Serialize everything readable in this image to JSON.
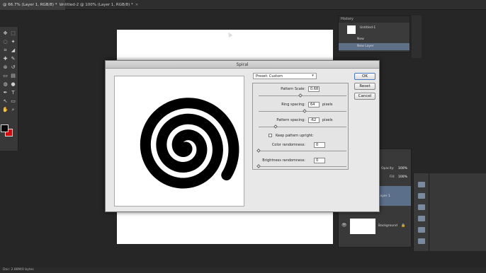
{
  "tabs": [
    {
      "label": "@ 66.7% (Layer 1, RGB/8) *",
      "close": "×"
    },
    {
      "label": "Untitled-2 @ 100% (Layer 1, RGB/8) *",
      "close": "×"
    }
  ],
  "tools": {
    "icons": [
      "move-icon",
      "marquee-icon",
      "lasso-icon",
      "magic-wand-icon",
      "crop-icon",
      "eyedropper-icon",
      "healing-icon",
      "brush-icon",
      "stamp-icon",
      "history-brush-icon",
      "eraser-icon",
      "gradient-icon",
      "blur-icon",
      "dodge-icon",
      "pen-icon",
      "type-icon",
      "path-select-icon",
      "shape-icon",
      "hand-icon",
      "zoom-icon"
    ],
    "glyphs": [
      "✥",
      "⬚",
      "◌",
      "✦",
      "⌗",
      "◢",
      "✚",
      "✎",
      "⊛",
      "↺",
      "▭",
      "▤",
      "◍",
      "●",
      "✒",
      "T",
      "↖",
      "▭",
      "✋",
      "⌕"
    ],
    "colors": {
      "foreground": "#000000",
      "background": "#d40a0a"
    }
  },
  "history": {
    "title": "History",
    "snapshot": "Untitled-1",
    "items": [
      "New",
      "New Layer"
    ]
  },
  "layers": {
    "opacity_label": "Opacity:",
    "opacity": "100%",
    "fill_label": "Fill:",
    "fill": "100%",
    "items": [
      "Layer 1",
      "Background"
    ]
  },
  "status": {
    "text": "Doc: 2.88M/0 bytes"
  },
  "dialog": {
    "title": "Spiral",
    "preset": "Preset: Custom",
    "buttons": {
      "ok": "OK",
      "reset": "Reset",
      "cancel": "Cancel"
    },
    "pattern_scale": {
      "label": "Pattern Scale:",
      "value": "0.68",
      "slider": 0.5
    },
    "ring_spacing": {
      "label": "Ring spacing:",
      "value": "64",
      "unit": "pixels",
      "slider": 0.55
    },
    "pattern_spacing": {
      "label": "Pattern spacing:",
      "value": "-62",
      "unit": "pixels",
      "slider": 0.2
    },
    "keep_upright": {
      "label": "Keep pattern upright:",
      "checked": false
    },
    "color_randomness": {
      "label": "Color randomness:",
      "value": "0",
      "slider": 0.0
    },
    "brightness_randomness": {
      "label": "Brightness randomness:",
      "value": "0",
      "slider": 0.0
    }
  }
}
